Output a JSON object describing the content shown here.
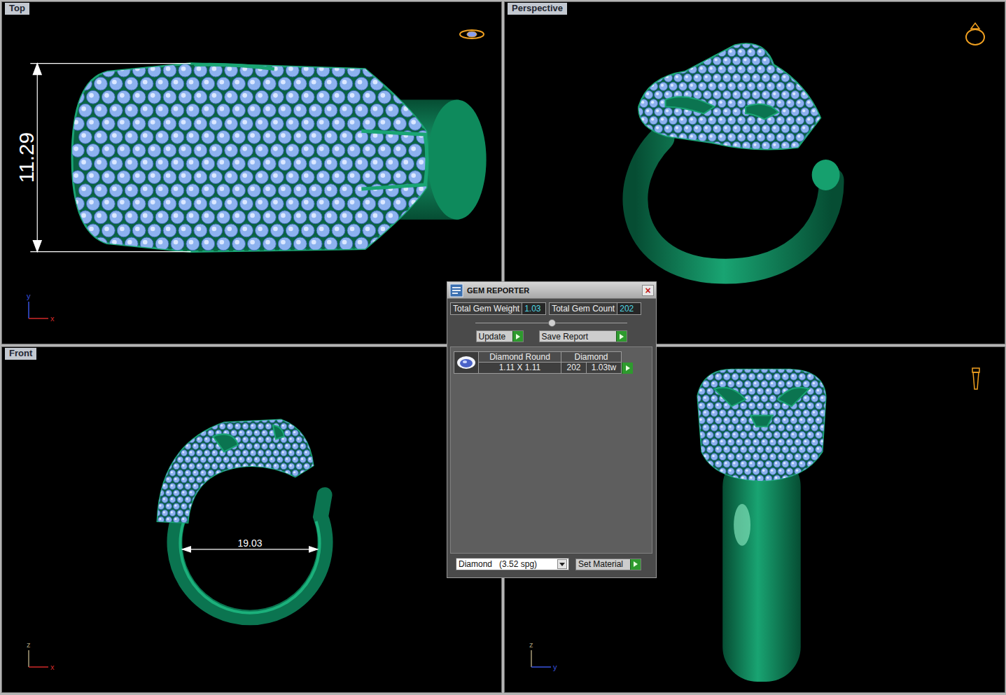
{
  "viewports": [
    {
      "kind": "top",
      "label": "Top",
      "dimension": "11.29",
      "axes": [
        {
          "label": "y",
          "kind": "vertical",
          "color": "#3a55e0"
        },
        {
          "label": "x",
          "kind": "horizontal",
          "color": "#d02a2a"
        }
      ]
    },
    {
      "kind": "perspective",
      "label": "Perspective",
      "axes": []
    },
    {
      "kind": "front",
      "label": "Front",
      "dimension": "19.03",
      "axes": [
        {
          "label": "z",
          "kind": "vertical",
          "color": "#a89c78"
        },
        {
          "label": "x",
          "kind": "horizontal",
          "color": "#d02a2a"
        }
      ]
    },
    {
      "kind": "right",
      "axes": [
        {
          "label": "z",
          "kind": "vertical",
          "color": "#a89c78"
        },
        {
          "label": "y",
          "kind": "horizontal",
          "color": "#3a55e0"
        }
      ]
    }
  ],
  "gem_reporter": {
    "title": "GEM REPORTER",
    "close": "×",
    "stats": [
      {
        "label": "Total Gem Weight",
        "value": "1.03"
      },
      {
        "label": "Total Gem Count",
        "value": "202"
      }
    ],
    "slider": {
      "level": 0.5
    },
    "buttons": [
      {
        "label": "Update"
      },
      {
        "label": "Save Report"
      }
    ],
    "table": {
      "columns": [
        "Diamond Round",
        "Diamond"
      ],
      "rows": [
        {
          "size": "1.11 X 1.11",
          "count": "202",
          "weight": "1.03tw"
        }
      ]
    },
    "material": {
      "name": "Diamond",
      "gravity": "(3.52 spg)"
    },
    "set_button": {
      "label": "Set Material"
    }
  }
}
